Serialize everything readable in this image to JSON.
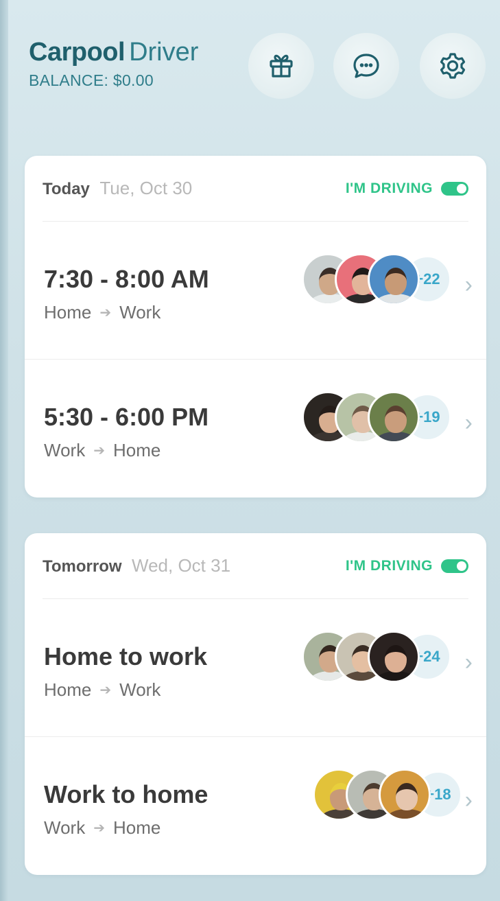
{
  "header": {
    "brand_strong": "Carpool",
    "brand_light": "Driver",
    "balance": "BALANCE: $0.00",
    "icons": [
      "gift-icon",
      "chat-icon",
      "settings-icon"
    ]
  },
  "colors": {
    "accent": "#2fc489",
    "brand": "#1f5f6c",
    "count": "#3aa7c9"
  },
  "days": [
    {
      "label": "Today",
      "date": "Tue, Oct 30",
      "driving_label": "I'M DRIVING",
      "driving_on": true,
      "rides": [
        {
          "title": "7:30 - 8:00 AM",
          "from": "Home",
          "to": "Work",
          "extra": "+22"
        },
        {
          "title": "5:30 - 6:00 PM",
          "from": "Work",
          "to": "Home",
          "extra": "+19"
        }
      ]
    },
    {
      "label": "Tomorrow",
      "date": "Wed, Oct 31",
      "driving_label": "I'M DRIVING",
      "driving_on": true,
      "rides": [
        {
          "title": "Home to work",
          "from": "Home",
          "to": "Work",
          "extra": "+24"
        },
        {
          "title": "Work to home",
          "from": "Work",
          "to": "Home",
          "extra": "+18"
        }
      ]
    }
  ]
}
